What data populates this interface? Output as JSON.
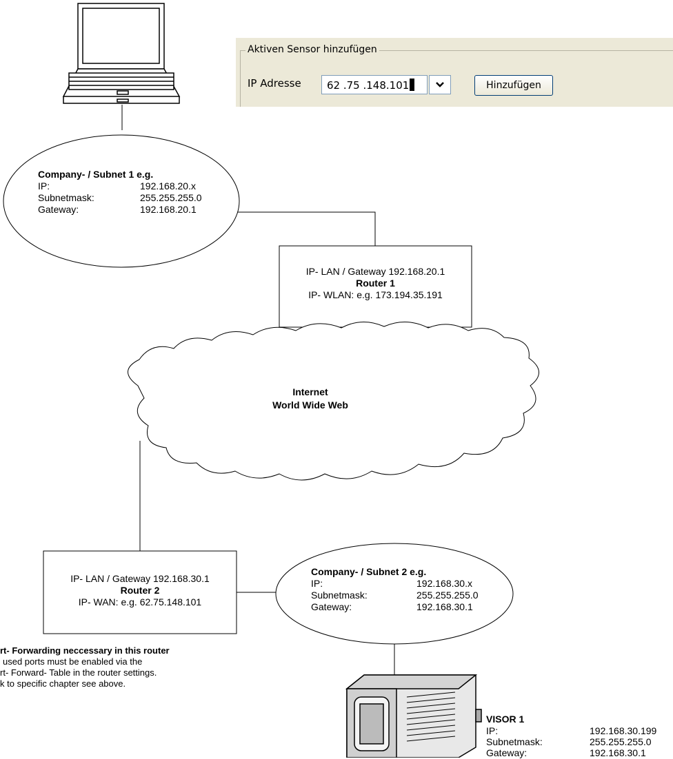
{
  "sensor_panel": {
    "group_title": "Aktiven Sensor hinzufügen",
    "ip_label": "IP Adresse",
    "ip_value": "62 .75 .148.101",
    "add_button": "Hinzufügen",
    "dropdown_icon": "chevron-down-icon"
  },
  "subnet1": {
    "title": "Company- / Subnet 1 e.g.",
    "rows": [
      {
        "label": "IP:",
        "value": "192.168.20.x"
      },
      {
        "label": "Subnetmask:",
        "value": "255.255.255.0"
      },
      {
        "label": "Gateway:",
        "value": "192.168.20.1"
      }
    ]
  },
  "router1": {
    "line1": "IP- LAN / Gateway 192.168.20.1",
    "name": "Router 1",
    "line3": "IP- WLAN: e.g. 173.194.35.191"
  },
  "internet": {
    "line1": "Internet",
    "line2": "World Wide Web"
  },
  "router2": {
    "line1": "IP- LAN / Gateway 192.168.30.1",
    "name": "Router 2",
    "line3": "IP- WAN: e.g. 62.75.148.101"
  },
  "subnet2": {
    "title": "Company- / Subnet 2 e.g.",
    "rows": [
      {
        "label": "IP:",
        "value": "192.168.30.x"
      },
      {
        "label": "Subnetmask:",
        "value": "255.255.255.0"
      },
      {
        "label": "Gateway:",
        "value": "192.168.30.1"
      }
    ]
  },
  "port_note": {
    "title": "rt- Forwarding neccessary in this router",
    "lines": [
      "used ports must be enabled via the",
      "rt- Forward- Table in the router settings.",
      "k to specific chapter see above."
    ]
  },
  "visor": {
    "title": "VISOR 1",
    "rows": [
      {
        "label": "IP:",
        "value": "192.168.30.199"
      },
      {
        "label": "Subnetmask:",
        "value": "255.255.255.0"
      },
      {
        "label": "Gateway:",
        "value": "192.168.30.1"
      }
    ]
  },
  "icons": {
    "laptop": "laptop-icon",
    "camera": "visor-sensor-icon"
  }
}
